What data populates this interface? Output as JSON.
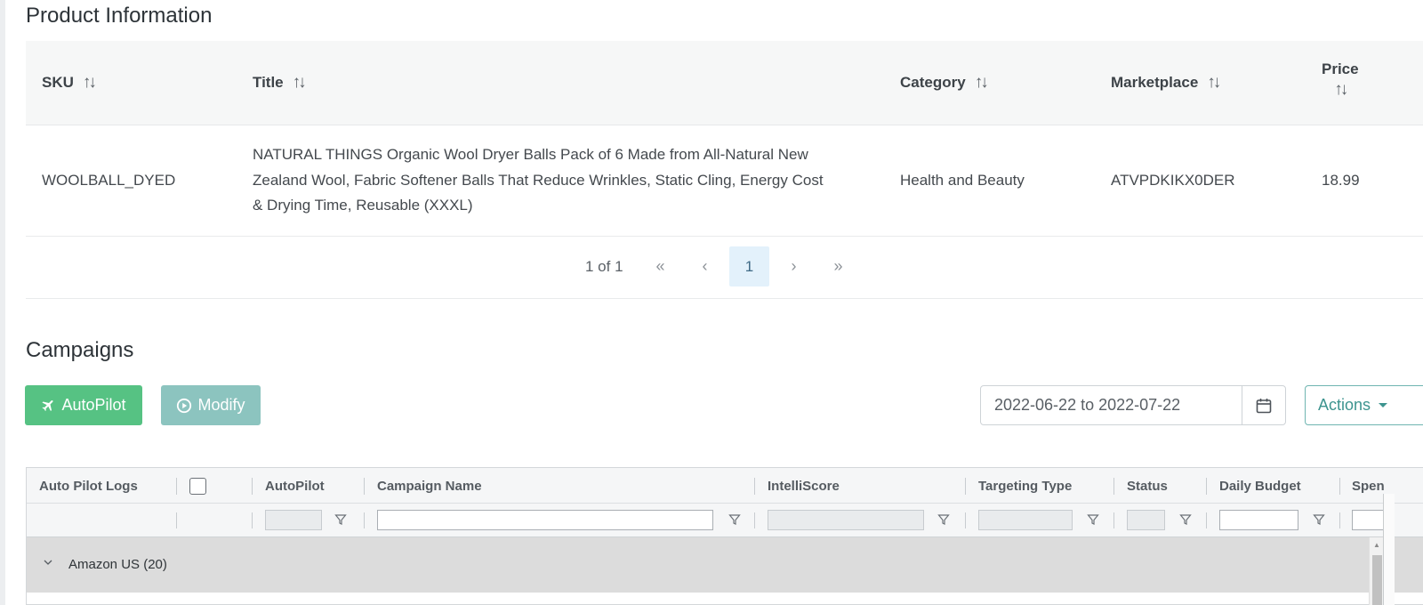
{
  "product_section": {
    "title": "Product Information",
    "columns": [
      "SKU",
      "Title",
      "Category",
      "Marketplace",
      "Price"
    ],
    "row": {
      "sku": "WOOLBALL_DYED",
      "title_lines": [
        "NATURAL THINGS Organic Wool Dryer Balls Pack of 6 Made from All-Natural New",
        "Zealand Wool, Fabric Softener Balls That Reduce Wrinkles, Static Cling, Energy Cost",
        "& Drying Time, Reusable (XXXL)"
      ],
      "category": "Health and Beauty",
      "marketplace": "ATVPDKIKX0DER",
      "price": "18.99"
    },
    "pagination": {
      "summary": "1 of 1",
      "current_page": "1",
      "first": "«",
      "prev": "‹",
      "next": "›",
      "last": "»"
    }
  },
  "campaigns_section": {
    "title": "Campaigns",
    "autopilot_button": "AutoPilot",
    "modify_button": "Modify",
    "date_range": "2022-06-22 to 2022-07-22",
    "actions_button": "Actions",
    "grid": {
      "columns": [
        "Auto Pilot Logs",
        "AutoPilot",
        "Campaign Name",
        "IntelliScore",
        "Targeting Type",
        "Status",
        "Daily Budget",
        "Spen"
      ],
      "group_row": "Amazon US (20)"
    }
  },
  "colors": {
    "autopilot_green": "#56c283",
    "modify_teal": "#8cc4bf",
    "actions_teal": "#3d948f",
    "header_bg": "#f6f7f7",
    "active_page_bg": "#e3f1fb"
  },
  "icons": [
    "sort-icon",
    "calendar-icon",
    "plane-icon",
    "play-circle-icon",
    "caret-down-icon",
    "filter-icon",
    "chevron-down-icon"
  ]
}
